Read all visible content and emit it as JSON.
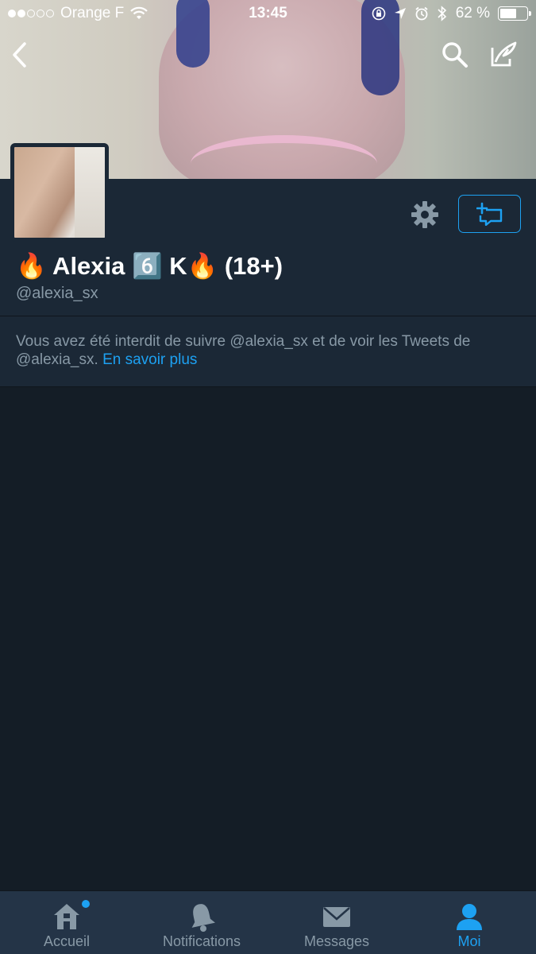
{
  "status_bar": {
    "carrier": "Orange F",
    "time": "13:45",
    "battery_percent": "62 %",
    "battery_level": 0.62
  },
  "nav": {
    "back_icon": "chevron-left-icon",
    "search_icon": "search-icon",
    "compose_icon": "compose-icon"
  },
  "profile": {
    "display_name": "🔥 Alexia 6️⃣ K🔥 (18+)",
    "username": "@alexia_sx"
  },
  "notice": {
    "text": "Vous avez été interdit de suivre @alexia_sx et de voir les Tweets de @alexia_sx.",
    "link": "En savoir plus"
  },
  "tabs": [
    {
      "label": "Accueil",
      "icon": "home-icon"
    },
    {
      "label": "Notifications",
      "icon": "bell-icon"
    },
    {
      "label": "Messages",
      "icon": "envelope-icon"
    },
    {
      "label": "Moi",
      "icon": "person-icon"
    }
  ],
  "colors": {
    "accent": "#1da1f2",
    "background": "#141d26",
    "panel": "#1b2836",
    "muted_text": "#8899a6",
    "tabbar": "#243447"
  }
}
